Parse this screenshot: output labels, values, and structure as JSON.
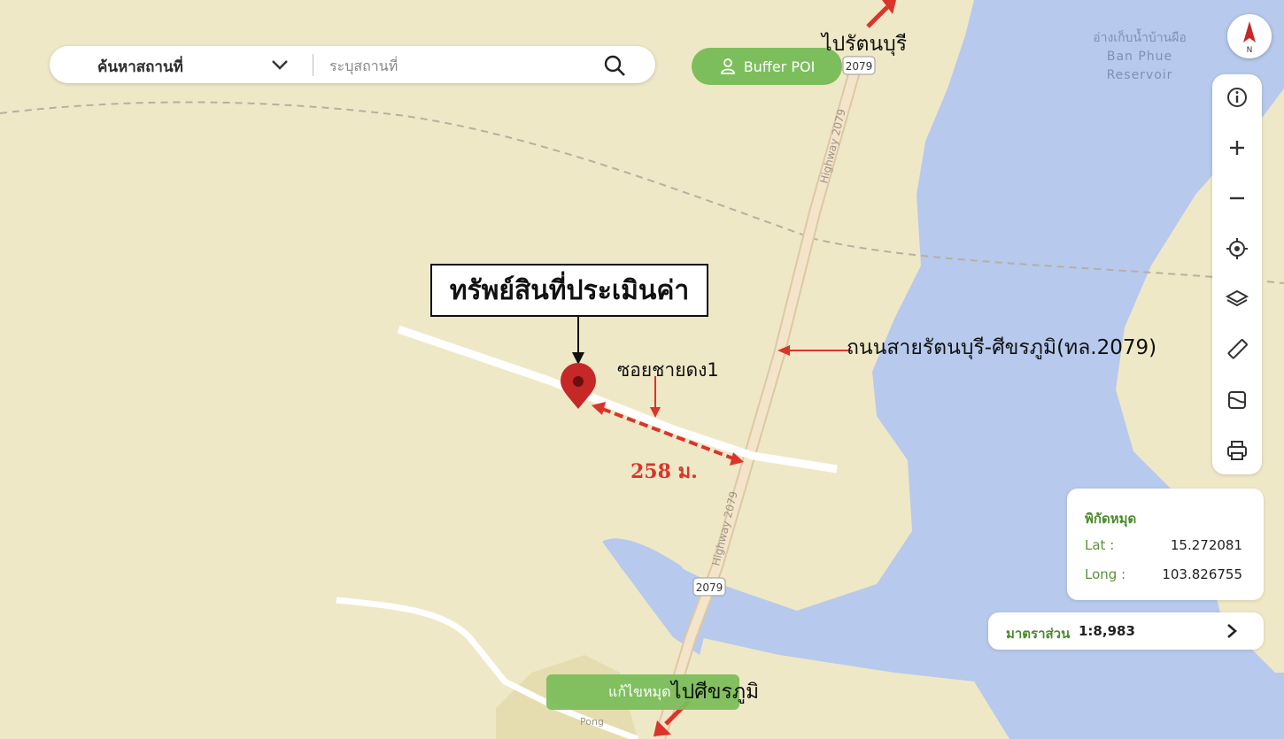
{
  "search": {
    "type_label": "ค้นหาสถานที่",
    "placeholder": "ระบุสถานที่"
  },
  "buffer_button": {
    "label": "Buffer POI"
  },
  "compass": {
    "letter": "N"
  },
  "toolbar": {
    "icons": [
      "info-icon",
      "zoom-in-icon",
      "zoom-out-icon",
      "locate-icon",
      "layers-icon",
      "ruler-icon",
      "map-style-icon",
      "print-icon"
    ]
  },
  "coordinates": {
    "title": "พิกัดหมุด",
    "lat_label": "Lat :",
    "lat_value": "15.272081",
    "long_label": "Long :",
    "long_value": "103.826755"
  },
  "scale": {
    "label": "มาตราส่วน",
    "value": "1:8,983"
  },
  "edit_button": {
    "label": "แก้ไขหมุด"
  },
  "map_labels": {
    "reservoir_th": "อ่างเก็บน้ำบ้านผือ",
    "reservoir_en_1": "Ban Phue",
    "reservoir_en_2": "Reservoir",
    "highway_name": "Highway 2079",
    "highway_shield": "2079",
    "pong": "Pong"
  },
  "annotations": {
    "asset": "ทรัพย์สินที่ประเมินค่า",
    "soi": "ซอยชายดง1",
    "distance": "258 ม.",
    "road": "ถนนสายรัตนบุรี-ศีขรภูมิ(ทล.2079)",
    "to_north": "ไปรัตนบุรี",
    "to_south": "ไปศีขรภูมิ"
  },
  "colors": {
    "land": "#efe8c7",
    "water": "#b7c9ec",
    "road": "#f3e0c4",
    "accent_green": "#7cbe5b",
    "marker": "#c62828",
    "annotation_red": "#d9352a"
  }
}
